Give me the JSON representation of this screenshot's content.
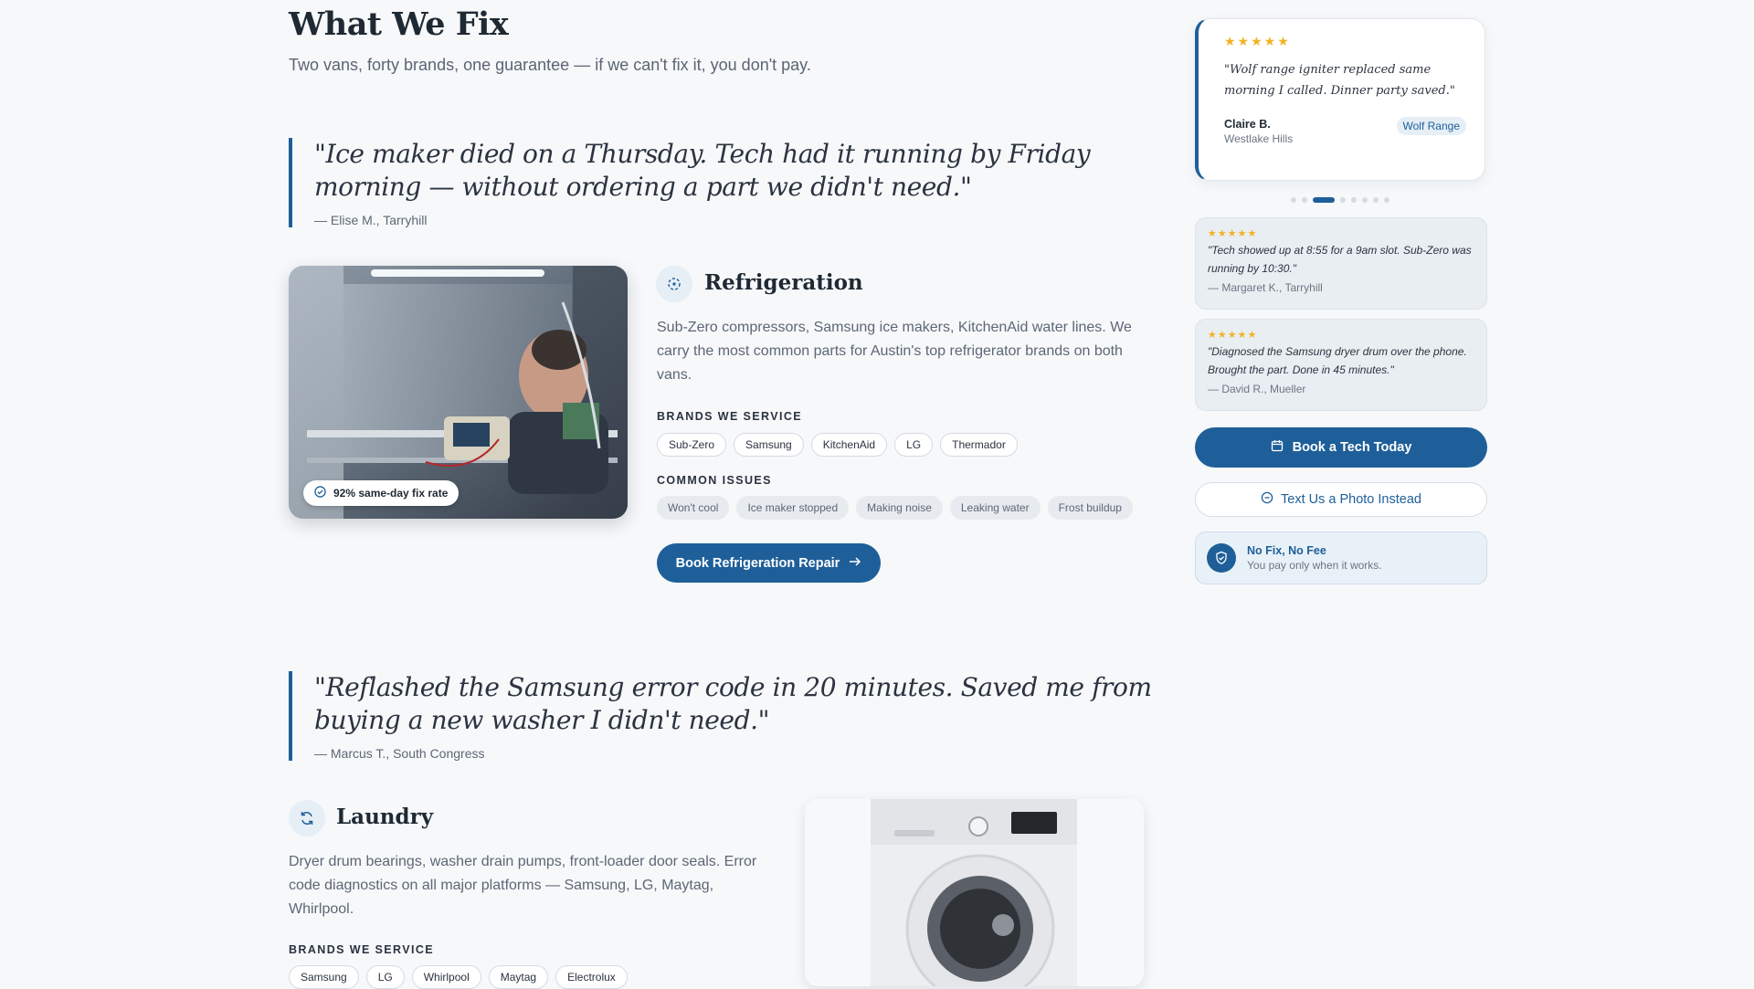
{
  "header": {
    "title": "What We Fix",
    "subtitle": "Two vans, forty brands, one guarantee — if we can't fix it, you don't pay."
  },
  "testimonials": [
    {
      "text": "\"Ice maker died on a Thursday. Tech had it running by Friday morning — without ordering a part we didn't need.\"",
      "author": "— Elise M., Tarryhill"
    },
    {
      "text": "\"Reflashed the Samsung error code in 20 minutes. Saved me from buying a new washer I didn't need.\"",
      "author": "— Marcus T., South Congress"
    }
  ],
  "refrigeration": {
    "icon": "snowflake-icon",
    "title": "Refrigeration",
    "description": "Sub-Zero compressors, Samsung ice makers, KitchenAid water lines. We carry the most common parts for Austin's top refrigerator brands on both vans.",
    "badge": "92% same-day fix rate",
    "brands_label": "BRANDS WE SERVICE",
    "brands": [
      "Sub-Zero",
      "Samsung",
      "KitchenAid",
      "LG",
      "Thermador"
    ],
    "issues_label": "COMMON ISSUES",
    "issues": [
      "Won't cool",
      "Ice maker stopped",
      "Making noise",
      "Leaking water",
      "Frost buildup"
    ],
    "cta": "Book Refrigeration Repair"
  },
  "laundry": {
    "icon": "refresh-icon",
    "title": "Laundry",
    "description": "Dryer drum bearings, washer drain pumps, front-loader door seals. Error code diagnostics on all major platforms — Samsung, LG, Maytag, Whirlpool.",
    "brands_label": "BRANDS WE SERVICE",
    "brands": [
      "Samsung",
      "LG",
      "Whirlpool",
      "Maytag",
      "Electrolux"
    ]
  },
  "sidebar": {
    "featured": {
      "stars": "★★★★★",
      "text": "\"Wolf range igniter replaced same morning I called. Dinner party saved.\"",
      "name": "Claire B.",
      "location": "Westlake Hills",
      "tag": "Wolf Range"
    },
    "carousel": {
      "count": 9,
      "active": 2
    },
    "reviews": [
      {
        "stars": "★★★★★",
        "text": "\"Tech showed up at 8:55 for a 9am slot. Sub-Zero was running by 10:30.\"",
        "author": "— Margaret K., Tarryhill"
      },
      {
        "stars": "★★★★★",
        "text": "\"Diagnosed the Samsung dryer drum over the phone. Brought the part. Done in 45 minutes.\"",
        "author": "— David R., Mueller"
      }
    ],
    "book_button": "Book a Tech Today",
    "text_button": "Text Us a Photo Instead",
    "guarantee_title": "No Fix, No Fee",
    "guarantee_sub": "You pay only when it works."
  },
  "colors": {
    "accent": "#1e5f99",
    "star": "#f1b323",
    "background": "#f6f8fa"
  }
}
